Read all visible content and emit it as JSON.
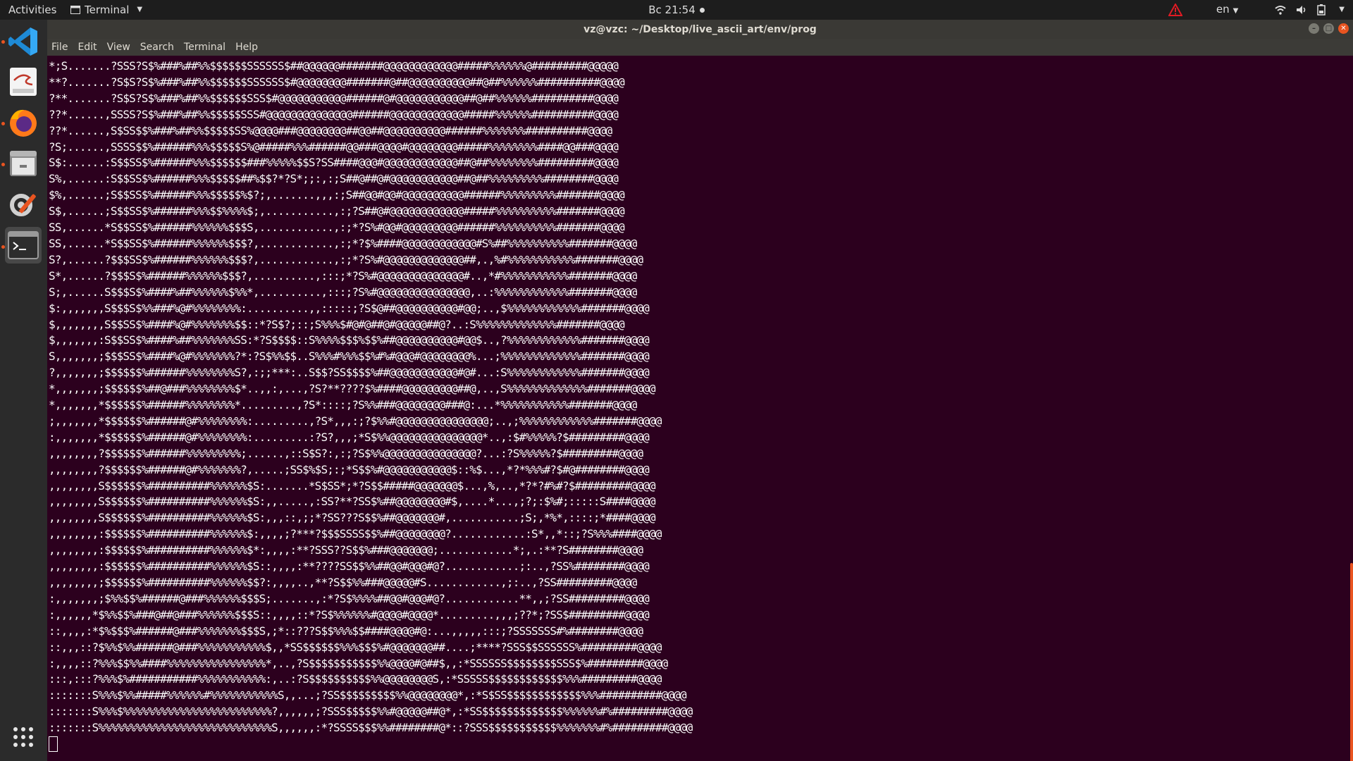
{
  "topbar": {
    "activities": "Activities",
    "app_name": "Terminal",
    "clock": "Вс 21:54",
    "language": "en",
    "warning_icon_color": "#e01b24"
  },
  "window": {
    "title": "vz@vzc: ~/Desktop/live_ascii_art/env/prog"
  },
  "menu": [
    "File",
    "Edit",
    "View",
    "Search",
    "Terminal",
    "Help"
  ],
  "dock": [
    "Visual Studio Code",
    "Text Editor",
    "Firefox",
    "Files",
    "Settings",
    "Terminal"
  ],
  "colors": {
    "accent": "#e95420",
    "terminal_bg": "#2c001e"
  },
  "terminal": {
    "lines": [
      "*;S.......?SSS?S$%###%##%%$$$$$$SSSSSS$##@@@@@@#######@@@@@@@@@@@@#####%%%%%%@#########@@@@@",
      "**?.......?S$S?S$%###%##%%$$$$$$SSSSSS$#@@@@@@@@#######@##@@@@@@@@@@##@##%%%%%%##########@@@@",
      "?**.......?S$S?S$%###%##%%$$$$$$SSS$#@@@@@@@@@@@######@#@@@@@@@@@@@##@##%%%%%%##########@@@@",
      "??*......,SSSS?S$%###%##%%$$$$$SSS#@@@@@@@@@@@@@@######@@@@@@@@@@@@#####%%%%%%##########@@@@",
      "??*......,S$SS$$%###%##%%$$$$$SS%@@@@###@@@@@@@@##@@##@@@@@@@@@@######%%%%%%%##########@@@@",
      "?S;......,SSSS$$%######%%%$$$$$S%@#####%%%######@@###@@@@#@@@@@@@@#####%%%%%%%%####@@###@@@@",
      "S$:......:S$$SS$%######%%%$$$$$$###%%%%%$$S?SS####@@@#@@@@@@@@@@@@##@##%%%%%%%%#########@@@@",
      "S%,......:S$$SS$%######%%%$$$$$##%$$?*?S*;;:,:;S##@##@#@@@@@@@@@@@##@##%%%%%%%%%########@@@@",
      "$%,......;S$$SS$%######%%%$$$$$%$?;,.......,,,:;S##@@#@@#@@@@@@@@@@######%%%%%%%%%#######@@@@",
      "S$,......;S$$SS$%######%%%$$%%%%$;,...........,:;?S##@#@@@@@@@@@@@@#####%%%%%%%%%%#######@@@@",
      "SS,......*S$$SS$%######%%%%%%$$$S,............,:;*?S%#@@#@@@@@@@@@######%%%%%%%%%%#######@@@@",
      "SS,......*S$$SS$%######%%%%%%$$$?,............,:;*?$%####@@@@@@@@@@@@#S%##%%%%%%%%%%#######@@@@",
      "S?,......?$$$SS$%######%%%%%%$$$?,............,:;*?S%#@@@@@@@@@@@@@##,.,%#%%%%%%%%%%%#######@@@@",
      "S*,......?$$$S$%######%%%%%%$$$?,..........,:::;*?S%#@@@@@@@@@@@@@@#..,*#%%%%%%%%%%%#######@@@@",
      "S;,......S$$$S$%####%##%%%%%%$%%*,..........,:::;?S%#@@@@@@@@@@@@@@@,..:%%%%%%%%%%%%#######@@@@",
      "$:,,,,,,,S$$$S$%%###%@#%%%%%%%%:..........,,:::::;?S$@##@@@@@@@@@@#@@;..,$%%%%%%%%%%%%#######@@@@",
      "$,,,,,,,,S$$SS$%####%@#%%%%%%%$$::*?S$?;::;S%%%$#@#@##@#@@@@@##@?..:S%%%%%%%%%%%%%#######@@@@",
      "$,,,,,,,:S$$SS$%####%##%%%%%%%SS:*?S$$$$::S%%%%$$$%$$%##@@@@@@@@@@#@@$..,?%%%%%%%%%%%%#######@@@@",
      "S,,,,,,,;$$$SS$%####%@#%%%%%%%?*:?S$%%$$..S%%%#%%%$$%#%#@@@#@@@@@@@@%...;%%%%%%%%%%%%%#######@@@@",
      "?,,,,,,,;$$$$$$%######%%%%%%%%S?,:;;***:..S$$?SS$$$$%##@@@@@@@@@@@#@#...:S%%%%%%%%%%%%#######@@@@",
      "*,,,,,,,;$$$$$$%##@###%%%%%%%%$*..,,:,...,?S?**????$%####@@@@@@@@@##@,..,S%%%%%%%%%%%%%#######@@@@",
      "*,,,,,,,*$$$$$$%######%%%%%%%%*.........,?S*::::;?S%%###@@@@@@@@###@:...*%%%%%%%%%%%#######@@@@",
      ";,,,,,,,*$$$$$$%######@#%%%%%%%%:.........,?S*,,,:;?$%%#@@@@@@@@@@@@@@@;..,;%%%%%%%%%%%%#######@@@@",
      ":,,,,,,,*$$$$$$%######@#%%%%%%%%:.........:?S?,,,;*S$%%@@@@@@@@@@@@@@@*..,:$#%%%%%?$#########@@@@",
      ",,,,,,,,?$$$$$$%######%%%%%%%%%;......,::S$S?:,:;?S$%%@@@@@@@@@@@@@@@?...:?S%%%%%?$#########@@@@",
      ",,,,,,,,?$$$$$$%######@#%%%%%%%?,.....;SS$%$S;:;*S$$%#@@@@@@@@@@@$::%$...,*?*%%%#?$#@########@@@@",
      ",,,,,,,,S$$$$$$%##########%%%%%%$S:.......*S$SS*;*?S$$#####@@@@@@@$...,%,..,*?*?#%#?$#########@@@@",
      ",,,,,,,,S$$$$$$%##########%%%%%%$S:,,.....,:SS?**?SS$%##@@@@@@@@#$,....*...,;?;:$%#;:::::S####@@@@",
      ",,,,,,,,S$$$$$$%##########%%%%%%$S:,,,::,;;*?SS???S$$%##@@@@@@@#,...........;S;,*%*,::::;*####@@@@",
      ",,,,,,,,:$$$$$$%##########%%%%%%$:,,,,;?***?$$$SSSS$$%##@@@@@@@@?............:S*,,*::;?S%%%####@@@@",
      ",,,,,,,,:$$$$$$%##########%%%%%%$*:,,,,:**?SSS??S$$%###@@@@@@@;............*;,.:**?S########@@@@",
      ",,,,,,,,:$$$$$$%##########%%%%%%$S::,,,,:**????SS$$%%##@@#@@@#@?............;:..,?SS%########@@@@",
      ",,,,,,,,;$$$$$$%##########%%%%%%$$?:,,,,..,**?S$$%%###@@@@@#S............,;:..,?SS#########@@@@",
      ":,,,,,,,;$%%$$%######@###%%%%%%$$$S;.......,:*?S$%%%%##@@#@@@#@?............**,,;?SS#########@@@@",
      ":,,,,,,*$%%$$%###@##@###%%%%%%$$$S::,,,,::*?S$%%%%%%#@@@@#@@@@*.........,,,;??*;?SS$#########@@@@",
      "::,,,,:*$%$$$%######@###%%%%%%%$$$S,;*::???S$$%%%$$####@@@@#@:...,,,,,:::;?SSSSSSS#%########@@@@",
      "::,,,::?$%%$%%######@###%%%%%%%%%%%$,,*SS$$$$$$%%%$$$%#@@@@@@@##....;****?SSS$$SSSSSS%#########@@@@",
      ":,,,,::?%%%$$%%####%%%%%%%%%%%%%%%%*,..,?S$$$$$$$$$$$%%@@@@#@##$,,:*SSSSSS$$$$$$$$SSS$%#########@@@@",
      ":::,:::?%%%$%###########%%%%%%%%%%%:,..:?S$$$$$$$$$$%%@@@@@@@@S,:*SSSSS$$$$$$$$$$$$%%%#########@@@@",
      ":::::::S%%%$%%#####%%%%%%#%%%%%%%%%%%S,,...;?SS$$$$$$$$$%%@@@@@@@@*,:*S$SS$$$$$$$$$$$$%%%##########@@@@",
      ":::::::S%%%$%%%%%%%%%%%%%%%%%%%%%%%%?,,,,,,;?SSS$$$$$%%#@@@@@##@*,:*SS$$$$$$$$$$$$$%%%%%%#%#########@@@@",
      ":::::::S%%%%%%%%%%%%%%%%%%%%%%%%%%%%S,,,,,,:*?SSSS$$$%%########@*::?SSS$$$$$$$$$$$%%%%%%%#%#########@@@@"
    ]
  }
}
